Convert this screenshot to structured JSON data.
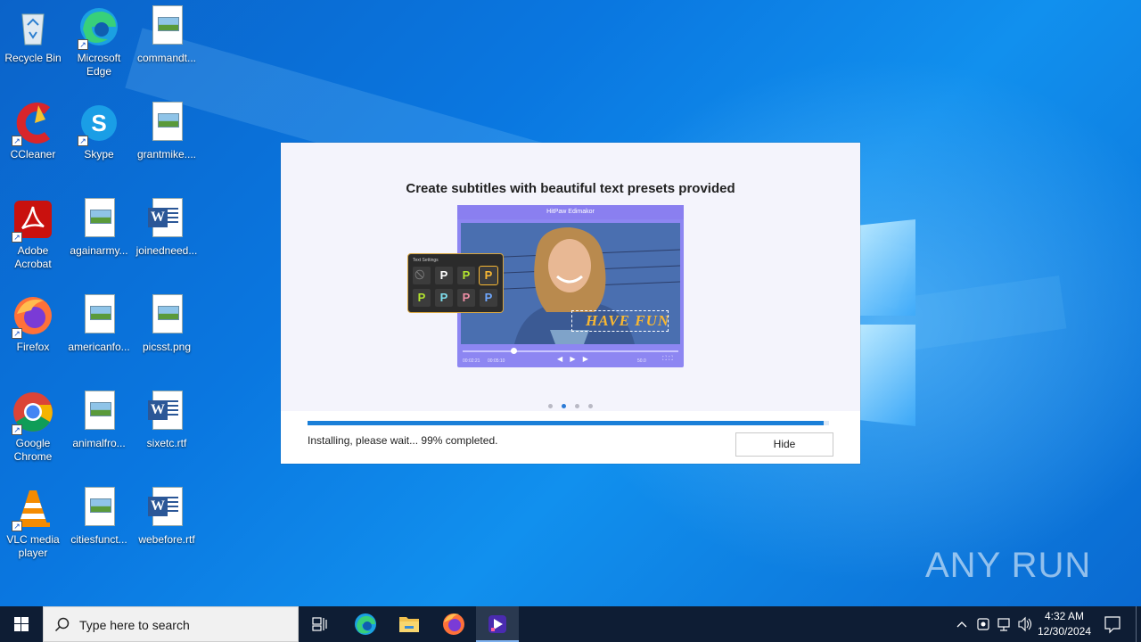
{
  "desktop": {
    "icons": [
      {
        "label": "Recycle Bin",
        "icon": "recycle-bin-icon"
      },
      {
        "label": "Microsoft Edge",
        "icon": "edge-icon"
      },
      {
        "label": "commandt...",
        "icon": "image-file-icon"
      },
      {
        "label": "CCleaner",
        "icon": "ccleaner-icon"
      },
      {
        "label": "Skype",
        "icon": "skype-icon"
      },
      {
        "label": "grantmike....",
        "icon": "image-file-icon"
      },
      {
        "label": "Adobe Acrobat",
        "icon": "acrobat-icon"
      },
      {
        "label": "againarmy...",
        "icon": "image-file-icon"
      },
      {
        "label": "joinedneed...",
        "icon": "word-file-icon"
      },
      {
        "label": "Firefox",
        "icon": "firefox-icon"
      },
      {
        "label": "americanfo...",
        "icon": "image-file-icon"
      },
      {
        "label": "picsst.png",
        "icon": "image-file-icon"
      },
      {
        "label": "Google Chrome",
        "icon": "chrome-icon"
      },
      {
        "label": "animalfro...",
        "icon": "image-file-icon"
      },
      {
        "label": "sixetc.rtf",
        "icon": "word-file-icon"
      },
      {
        "label": "VLC media player",
        "icon": "vlc-icon"
      },
      {
        "label": "citiesfunct...",
        "icon": "image-file-icon"
      },
      {
        "label": "webefore.rtf",
        "icon": "word-file-icon"
      }
    ]
  },
  "installer": {
    "headline": "Create subtitles with beautiful text presets provided",
    "preview": {
      "app_title": "HitPaw Edimakor",
      "panel_title": "Text Settings",
      "overlay_text": "HAVE FUN",
      "time_current": "00:02:21",
      "time_total": "00:05:10",
      "zoom": "50.0",
      "preset_glyph": "P"
    },
    "slides": {
      "count": 4,
      "active_index": 1
    },
    "progress_percent": 99,
    "status_text": "Installing, please wait... 99% completed.",
    "hide_label": "Hide"
  },
  "watermark": "ANY RUN",
  "taskbar": {
    "search_placeholder": "Type here to search",
    "pinned": [
      "task-view-icon",
      "edge-icon",
      "file-explorer-icon",
      "firefox-icon",
      "hitpaw-installer-icon"
    ],
    "clock_time": "4:32 AM",
    "clock_date": "12/30/2024"
  },
  "colors": {
    "accent": "#1a7fd8",
    "wallpaper": "#0a77e0",
    "taskbar": "#0e1d34",
    "preview_purple": "#8d86f2",
    "panel_border": "#d8a640"
  }
}
